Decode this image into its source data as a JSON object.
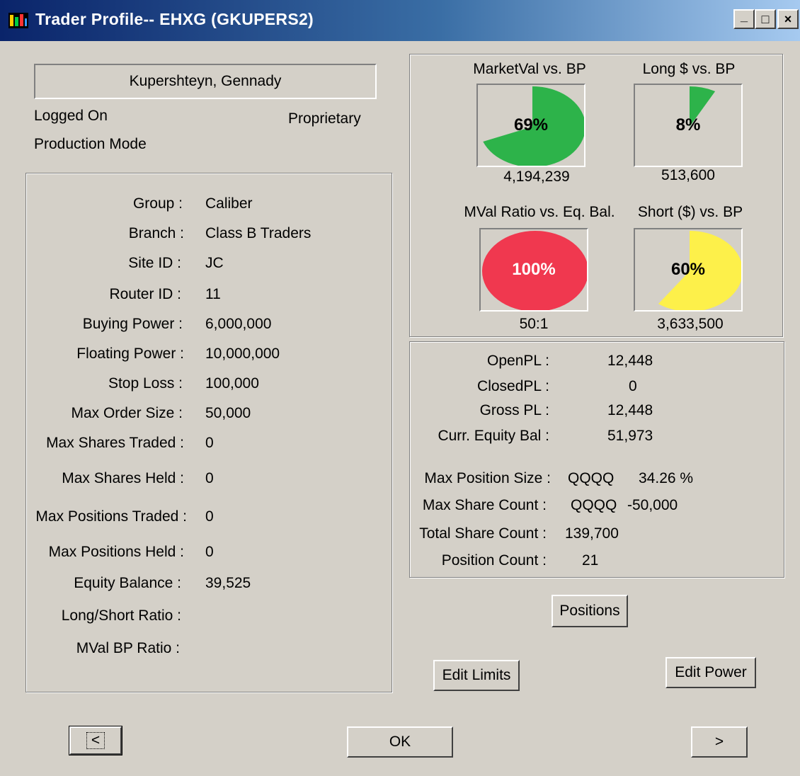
{
  "window": {
    "title": "Trader Profile-- EHXG (GKUPERS2)",
    "minimize": "_",
    "maximize": "□",
    "close": "×"
  },
  "trader": {
    "name": "Kupershteyn, Gennady",
    "status": "Logged On",
    "mode": "Production Mode",
    "type": "Proprietary"
  },
  "profile": {
    "fields": [
      {
        "label": "Group :",
        "value": "Caliber"
      },
      {
        "label": "Branch :",
        "value": "Class B Traders"
      },
      {
        "label": "Site ID :",
        "value": "JC"
      },
      {
        "label": "Router ID :",
        "value": "11"
      },
      {
        "label": "Buying Power :",
        "value": "6,000,000"
      },
      {
        "label": "Floating Power :",
        "value": "10,000,000"
      },
      {
        "label": "Stop Loss :",
        "value": "100,000"
      },
      {
        "label": "Max Order Size :",
        "value": "50,000"
      },
      {
        "label": "Max Shares Traded :",
        "value": "0"
      },
      {
        "label": "Max Shares Held :",
        "value": "0"
      },
      {
        "label": "Max Positions Traded :",
        "value": "0"
      },
      {
        "label": "Max Positions Held :",
        "value": "0"
      },
      {
        "label": "Equity Balance :",
        "value": "39,525"
      },
      {
        "label": "Long/Short Ratio :",
        "value": ""
      },
      {
        "label": "MVal BP Ratio :",
        "value": ""
      }
    ]
  },
  "gauges": [
    {
      "title": "MarketVal vs. BP",
      "percent_label": "69%",
      "fraction": 0.69,
      "color": "#2db34a",
      "value": "4,194,239"
    },
    {
      "title": "Long $ vs. BP",
      "percent_label": "8%",
      "fraction": 0.08,
      "color": "#2db34a",
      "value": "513,600"
    },
    {
      "title": "MVal Ratio vs. Eq. Bal.",
      "percent_label": "100%",
      "fraction": 1.0,
      "color": "#f0384f",
      "value": "50:1"
    },
    {
      "title": "Short ($) vs. BP",
      "percent_label": "60%",
      "fraction": 0.6,
      "color": "#fdf04a",
      "value": "3,633,500"
    }
  ],
  "pl": {
    "open_label": "OpenPL :",
    "open_value": "12,448",
    "closed_label": "ClosedPL :",
    "closed_value": "0",
    "gross_label": "Gross PL :",
    "gross_value": "12,448",
    "equity_label": "Curr. Equity Bal :",
    "equity_value": "51,973",
    "max_pos_label": "Max Position Size :",
    "max_pos_symbol": "QQQQ",
    "max_pos_value": "34.26 %",
    "max_share_label": "Max Share Count :",
    "max_share_symbol": "QQQQ",
    "max_share_value": "-50,000",
    "total_share_label": "Total Share Count :",
    "total_share_value": "139,700",
    "pos_count_label": "Position Count :",
    "pos_count_value": "21"
  },
  "buttons": {
    "positions": "Positions",
    "edit_limits": "Edit Limits",
    "edit_power": "Edit Power",
    "prev": "<",
    "ok": "OK",
    "next": ">"
  }
}
